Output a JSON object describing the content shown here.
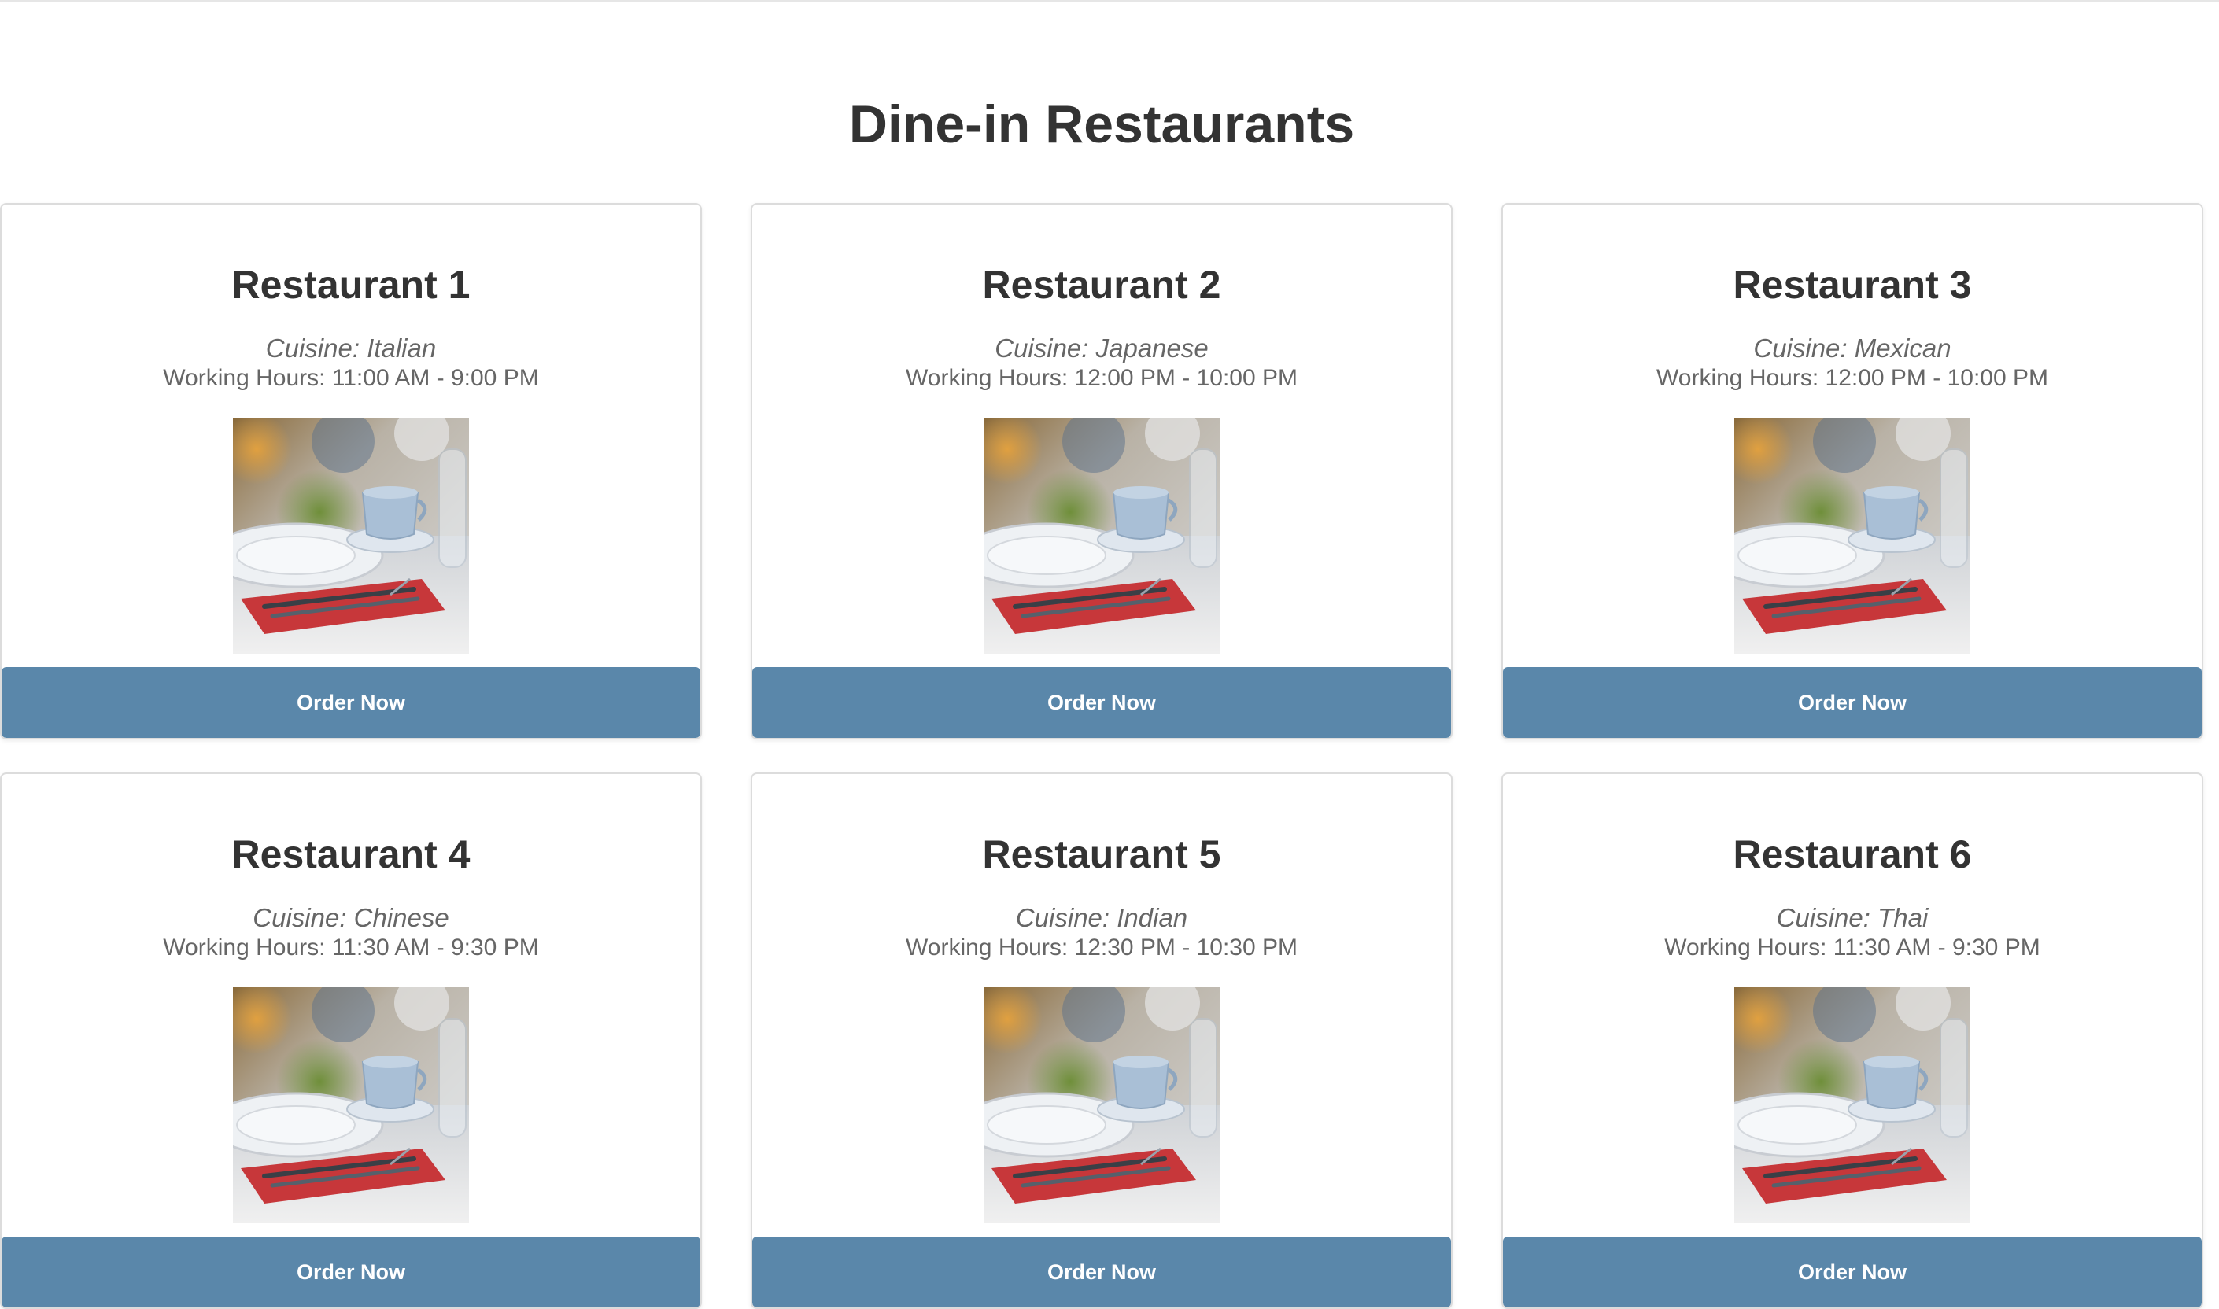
{
  "page": {
    "title": "Dine-in Restaurants"
  },
  "colors": {
    "button": "#5a87aa",
    "text": "#333333",
    "muted": "#666666"
  },
  "restaurants": [
    {
      "name": "Restaurant 1",
      "cuisine": "Cuisine: Italian",
      "hours": "Working Hours: 11:00 AM - 9:00 PM",
      "button": "Order Now",
      "image_alt": "Restaurant table setting"
    },
    {
      "name": "Restaurant 2",
      "cuisine": "Cuisine: Japanese",
      "hours": "Working Hours: 12:00 PM - 10:00 PM",
      "button": "Order Now",
      "image_alt": "Restaurant table setting"
    },
    {
      "name": "Restaurant 3",
      "cuisine": "Cuisine: Mexican",
      "hours": "Working Hours: 12:00 PM - 10:00 PM",
      "button": "Order Now",
      "image_alt": "Restaurant table setting"
    },
    {
      "name": "Restaurant 4",
      "cuisine": "Cuisine: Chinese",
      "hours": "Working Hours: 11:30 AM - 9:30 PM",
      "button": "Order Now",
      "image_alt": "Restaurant table setting"
    },
    {
      "name": "Restaurant 5",
      "cuisine": "Cuisine: Indian",
      "hours": "Working Hours: 12:30 PM - 10:30 PM",
      "button": "Order Now",
      "image_alt": "Restaurant table setting"
    },
    {
      "name": "Restaurant 6",
      "cuisine": "Cuisine: Thai",
      "hours": "Working Hours: 11:30 AM - 9:30 PM",
      "button": "Order Now",
      "image_alt": "Restaurant table setting"
    }
  ]
}
